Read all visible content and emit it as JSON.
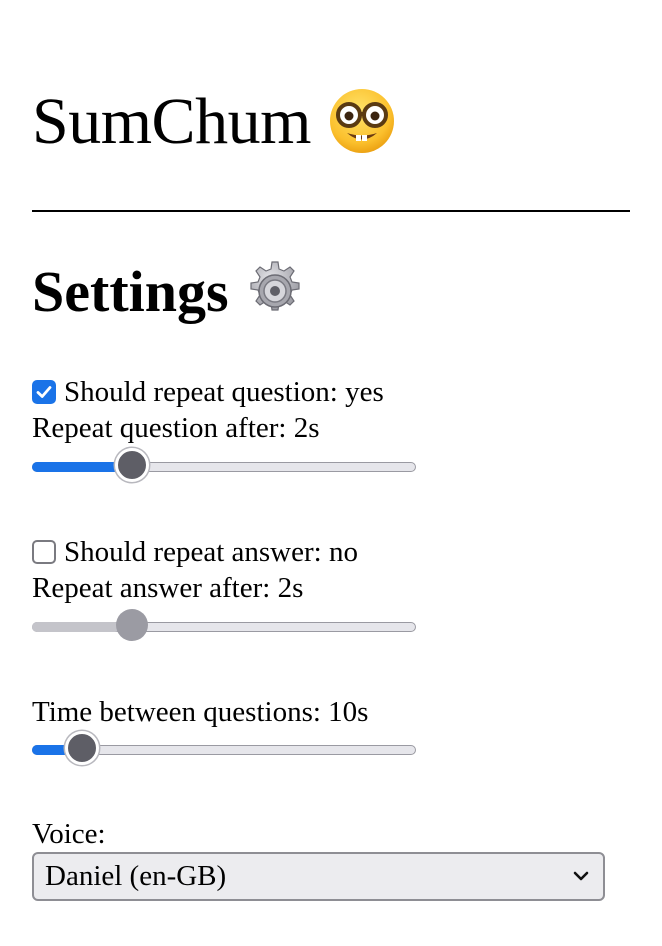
{
  "header": {
    "title": "SumChum",
    "emoji_icon": "nerd-face-icon"
  },
  "settings": {
    "title": "Settings",
    "emoji_icon": "gear-icon",
    "repeat_question": {
      "checked": true,
      "label": "Should repeat question: yes",
      "delay_label": "Repeat question after: 2s",
      "slider_fraction": 0.23,
      "enabled": true
    },
    "repeat_answer": {
      "checked": false,
      "label": "Should repeat answer: no",
      "delay_label": "Repeat answer after: 2s",
      "slider_fraction": 0.23,
      "enabled": false
    },
    "time_between": {
      "label": "Time between questions: 10s",
      "slider_fraction": 0.1,
      "enabled": true
    },
    "voice": {
      "label": "Voice:",
      "selected": "Daniel (en-GB)"
    }
  },
  "colors": {
    "accent": "#1a73e8",
    "thumb": "#5e5e66",
    "disabled_thumb": "#9b9ba3",
    "track": "#e6e6eb"
  }
}
